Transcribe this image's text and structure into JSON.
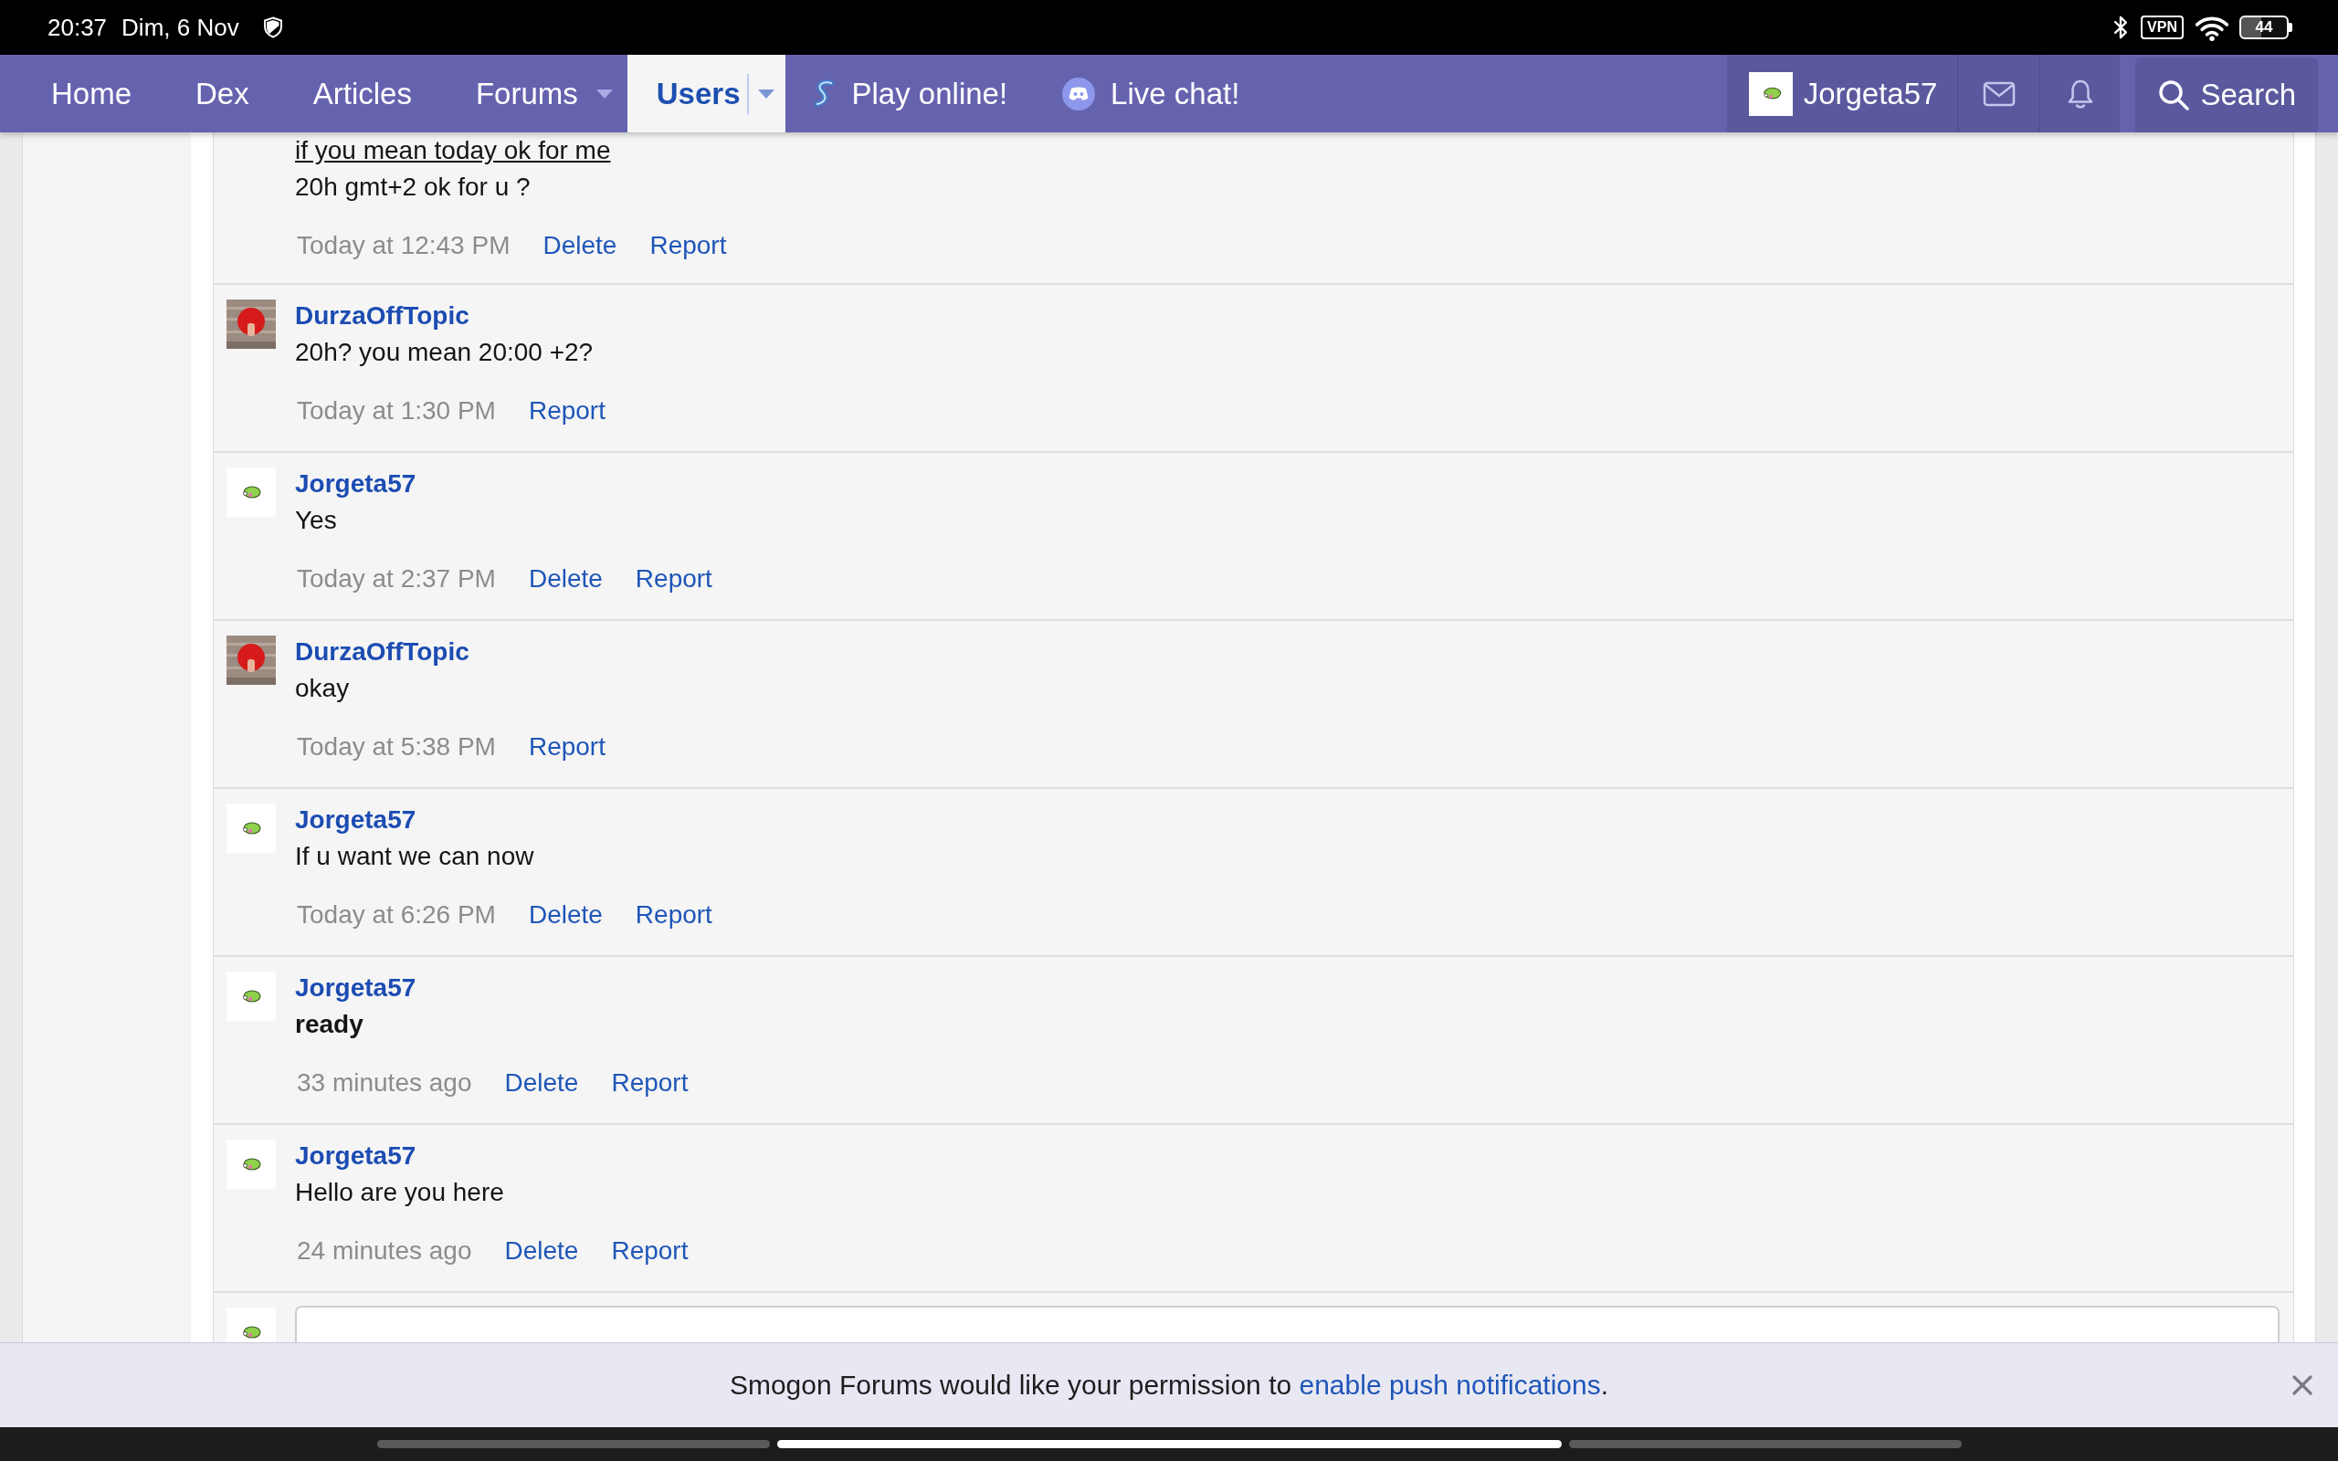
{
  "status_bar": {
    "time": "20:37",
    "date": "Dim, 6 Nov",
    "vpn": "VPN",
    "battery": "44"
  },
  "nav": {
    "tabs": [
      {
        "label": "Home",
        "selected": false,
        "menu": false
      },
      {
        "label": "Dex",
        "selected": false,
        "menu": false
      },
      {
        "label": "Articles",
        "selected": false,
        "menu": false
      },
      {
        "label": "Forums",
        "selected": false,
        "menu": true
      },
      {
        "label": "Users",
        "selected": true,
        "menu": true
      }
    ],
    "links": [
      {
        "label": "Play online!",
        "kind": "play"
      },
      {
        "label": "Live chat!",
        "kind": "chat"
      }
    ],
    "account": {
      "username": "Jorgeta57"
    },
    "search": {
      "label": "Search"
    }
  },
  "comments": [
    {
      "lines": [
        {
          "text": "if you mean today ok for me",
          "kind": "underline"
        },
        {
          "text": "20h gmt+2 ok for u ?",
          "kind": "plain"
        }
      ],
      "time": "Today at 12:43 PM",
      "actions": [
        "Delete",
        "Report"
      ]
    },
    {
      "author": "DurzaOffTopic",
      "avatar": {
        "kind": "photo"
      },
      "lines": [
        {
          "text": "20h? you mean 20:00 +2?",
          "kind": "plain"
        }
      ],
      "time": "Today at 1:30 PM",
      "actions": [
        "Report"
      ]
    },
    {
      "author": "Jorgeta57",
      "avatar": {
        "kind": "sprite"
      },
      "lines": [
        {
          "text": "Yes",
          "kind": "plain"
        }
      ],
      "time": "Today at 2:37 PM",
      "actions": [
        "Delete",
        "Report"
      ]
    },
    {
      "author": "DurzaOffTopic",
      "avatar": {
        "kind": "photo"
      },
      "lines": [
        {
          "text": "okay",
          "kind": "plain"
        }
      ],
      "time": "Today at 5:38 PM",
      "actions": [
        "Report"
      ]
    },
    {
      "author": "Jorgeta57",
      "avatar": {
        "kind": "sprite"
      },
      "lines": [
        {
          "text": "If u want we can now",
          "kind": "plain"
        }
      ],
      "time": "Today at 6:26 PM",
      "actions": [
        "Delete",
        "Report"
      ]
    },
    {
      "author": "Jorgeta57",
      "avatar": {
        "kind": "sprite"
      },
      "lines": [
        {
          "text": "ready",
          "kind": "bold"
        }
      ],
      "time": "33 minutes ago",
      "actions": [
        "Delete",
        "Report"
      ]
    },
    {
      "author": "Jorgeta57",
      "avatar": {
        "kind": "sprite"
      },
      "lines": [
        {
          "text": "Hello are you here",
          "kind": "plain"
        }
      ],
      "time": "24 minutes ago",
      "actions": [
        "Delete",
        "Report"
      ]
    }
  ],
  "banner": {
    "message": "Smogon Forums would like your permission to",
    "link": "enable push notifications",
    "end": "."
  },
  "page_indicators": [
    {
      "selected": false
    },
    {
      "selected": true
    },
    {
      "selected": false
    }
  ]
}
